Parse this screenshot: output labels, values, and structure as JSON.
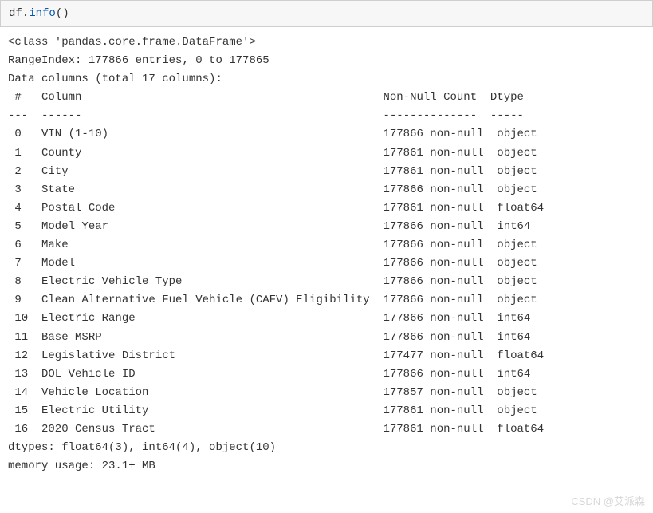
{
  "code": {
    "obj": "df.",
    "method": "info",
    "parens": "()"
  },
  "output": {
    "class_line": "<class 'pandas.core.frame.DataFrame'>",
    "range_index": "RangeIndex: 177866 entries, 0 to 177865",
    "data_columns": "Data columns (total 17 columns):",
    "header_idx": " #  ",
    "header_col": " Column                                            ",
    "header_nn": " Non-Null Count ",
    "header_dt": " Dtype  ",
    "sep_idx": "--- ",
    "sep_col": " ------                                            ",
    "sep_nn": " -------------- ",
    "sep_dt": " -----  ",
    "rows": [
      {
        "idx": " 0  ",
        "col": " VIN (1-10)                                        ",
        "nn": " 177866 non-null",
        "dt": "  object "
      },
      {
        "idx": " 1  ",
        "col": " County                                            ",
        "nn": " 177861 non-null",
        "dt": "  object "
      },
      {
        "idx": " 2  ",
        "col": " City                                              ",
        "nn": " 177861 non-null",
        "dt": "  object "
      },
      {
        "idx": " 3  ",
        "col": " State                                             ",
        "nn": " 177866 non-null",
        "dt": "  object "
      },
      {
        "idx": " 4  ",
        "col": " Postal Code                                       ",
        "nn": " 177861 non-null",
        "dt": "  float64"
      },
      {
        "idx": " 5  ",
        "col": " Model Year                                        ",
        "nn": " 177866 non-null",
        "dt": "  int64  "
      },
      {
        "idx": " 6  ",
        "col": " Make                                              ",
        "nn": " 177866 non-null",
        "dt": "  object "
      },
      {
        "idx": " 7  ",
        "col": " Model                                             ",
        "nn": " 177866 non-null",
        "dt": "  object "
      },
      {
        "idx": " 8  ",
        "col": " Electric Vehicle Type                             ",
        "nn": " 177866 non-null",
        "dt": "  object "
      },
      {
        "idx": " 9  ",
        "col": " Clean Alternative Fuel Vehicle (CAFV) Eligibility ",
        "nn": " 177866 non-null",
        "dt": "  object "
      },
      {
        "idx": " 10 ",
        "col": " Electric Range                                    ",
        "nn": " 177866 non-null",
        "dt": "  int64  "
      },
      {
        "idx": " 11 ",
        "col": " Base MSRP                                         ",
        "nn": " 177866 non-null",
        "dt": "  int64  "
      },
      {
        "idx": " 12 ",
        "col": " Legislative District                              ",
        "nn": " 177477 non-null",
        "dt": "  float64"
      },
      {
        "idx": " 13 ",
        "col": " DOL Vehicle ID                                    ",
        "nn": " 177866 non-null",
        "dt": "  int64  "
      },
      {
        "idx": " 14 ",
        "col": " Vehicle Location                                  ",
        "nn": " 177857 non-null",
        "dt": "  object "
      },
      {
        "idx": " 15 ",
        "col": " Electric Utility                                  ",
        "nn": " 177861 non-null",
        "dt": "  object "
      },
      {
        "idx": " 16 ",
        "col": " 2020 Census Tract                                 ",
        "nn": " 177861 non-null",
        "dt": "  float64"
      }
    ],
    "dtypes_line": "dtypes: float64(3), int64(4), object(10)",
    "memory_line": "memory usage: 23.1+ MB"
  },
  "watermark": "CSDN @艾派森"
}
